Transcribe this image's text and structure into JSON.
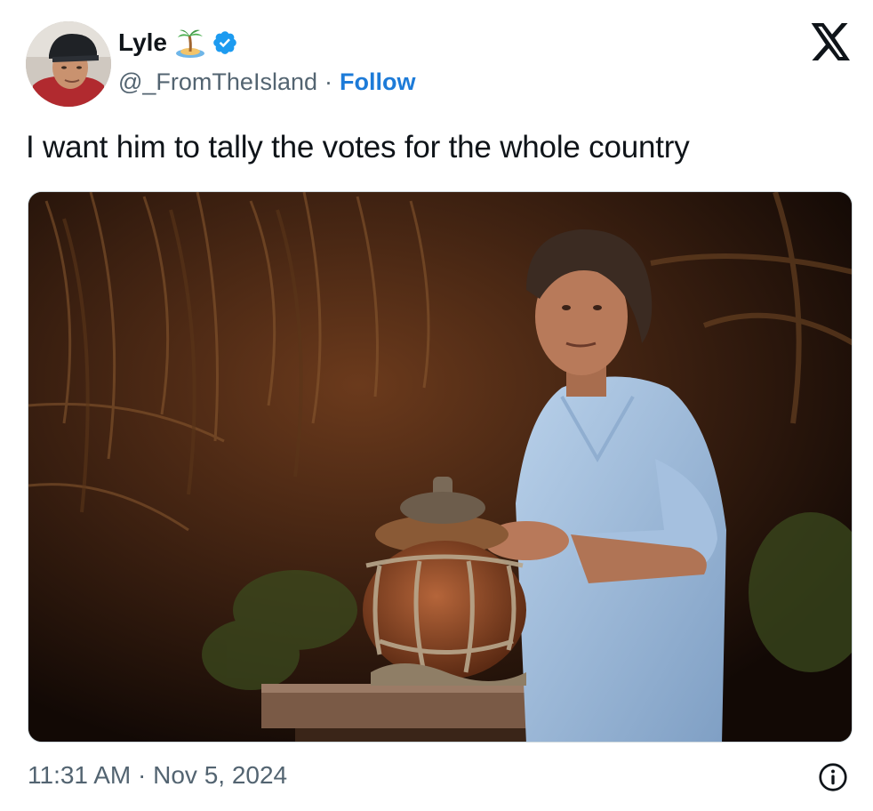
{
  "author": {
    "display_name": "Lyle",
    "emoji_icon": "desert-island-icon",
    "verified_icon": "verified-badge-icon",
    "handle": "@_FromTheIsland",
    "separator": "·",
    "follow_label": "Follow"
  },
  "platform_icon": "x-logo-icon",
  "tweet": {
    "text": "I want him to tally the votes for the whole country"
  },
  "meta": {
    "time": "11:31 AM",
    "separator": "·",
    "date": "Nov 5, 2024",
    "info_icon": "info-icon"
  },
  "colors": {
    "accent": "#1d7bd8",
    "text": "#0f1419",
    "secondary": "#536471",
    "verified": "#1d9bf0"
  }
}
